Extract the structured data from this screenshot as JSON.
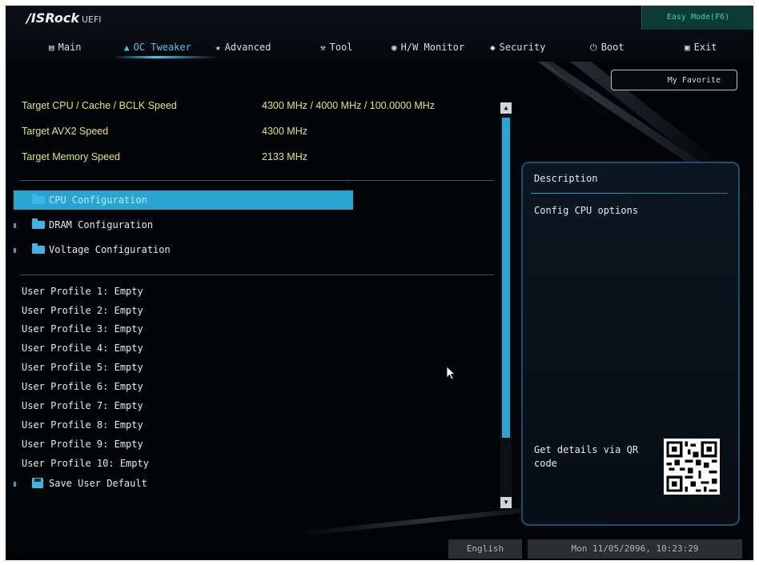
{
  "header": {
    "brand": "/ISRock",
    "brand_suffix": "UEFI",
    "easy_mode_label": "Easy Mode(F6)"
  },
  "tabs": [
    {
      "label": "Main",
      "icon": "list-icon",
      "active": false
    },
    {
      "label": "OC Tweaker",
      "icon": "rocket-icon",
      "active": true
    },
    {
      "label": "Advanced",
      "icon": "star-icon",
      "active": false
    },
    {
      "label": "Tool",
      "icon": "tools-icon",
      "active": false
    },
    {
      "label": "H/W Monitor",
      "icon": "monitor-icon",
      "active": false
    },
    {
      "label": "Security",
      "icon": "shield-icon",
      "active": false
    },
    {
      "label": "Boot",
      "icon": "power-icon",
      "active": false
    },
    {
      "label": "Exit",
      "icon": "exit-icon",
      "active": false
    }
  ],
  "my_favorite_label": "My Favorite",
  "targets": [
    {
      "label": "Target CPU / Cache / BCLK Speed",
      "value": "4300 MHz / 4000 MHz / 100.0000 MHz"
    },
    {
      "label": "Target AVX2 Speed",
      "value": "4300 MHz"
    },
    {
      "label": "Target Memory Speed",
      "value": "2133 MHz"
    }
  ],
  "menu": [
    {
      "label": "CPU Configuration",
      "selected": true
    },
    {
      "label": "DRAM Configuration",
      "selected": false
    },
    {
      "label": "Voltage Configuration",
      "selected": false
    }
  ],
  "profiles": [
    "User Profile 1: Empty",
    "User Profile 2: Empty",
    "User Profile 3: Empty",
    "User Profile 4: Empty",
    "User Profile 5: Empty",
    "User Profile 6: Empty",
    "User Profile 7: Empty",
    "User Profile 8: Empty",
    "User Profile 9: Empty",
    "User Profile 10: Empty"
  ],
  "save_default_label": "Save User Default",
  "description": {
    "title": "Description",
    "text": "Config CPU options",
    "qr_caption": "Get details via QR code"
  },
  "footer": {
    "language": "English",
    "datetime": "Mon 11/05/2096, 10:23:29"
  },
  "colors": {
    "accent": "#2aa4d0",
    "target_text": "#e8e36c",
    "active_tab": "#4cc6ee"
  }
}
